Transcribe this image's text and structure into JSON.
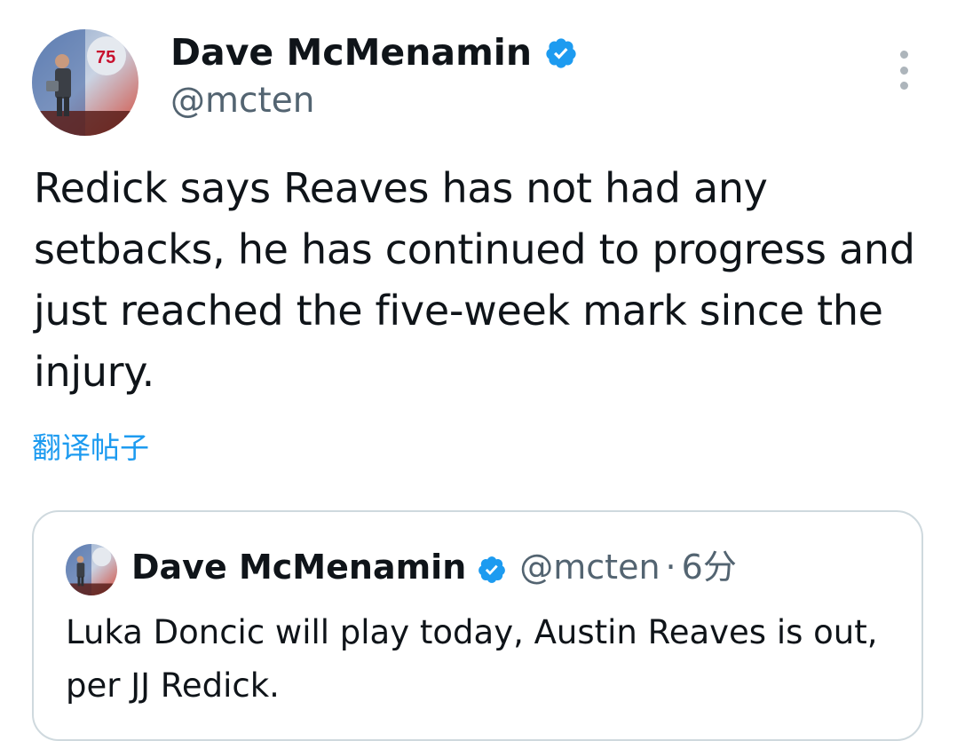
{
  "author": {
    "display_name": "Dave McMenamin",
    "handle": "@mcten",
    "verified": true,
    "avatar_icon": "nba-75-avatar"
  },
  "tweet": {
    "text": "Redick says Reaves has not had any setbacks, he has continued to progress and just reached the five-week mark since the injury.",
    "translate_label": "翻译帖子"
  },
  "quoted_tweet": {
    "display_name": "Dave McMenamin",
    "handle": "@mcten",
    "separator": "·",
    "time": "6分",
    "verified": true,
    "text": "Luka Doncic will play today, Austin Reaves is out, per JJ Redick."
  },
  "colors": {
    "text_primary": "#0f1419",
    "text_secondary": "#536471",
    "link": "#1d9bf0",
    "verified_badge": "#1d9bf0",
    "border": "#cfd9de"
  },
  "icons": {
    "more": "more-options-icon",
    "verified": "verified-badge-icon"
  }
}
